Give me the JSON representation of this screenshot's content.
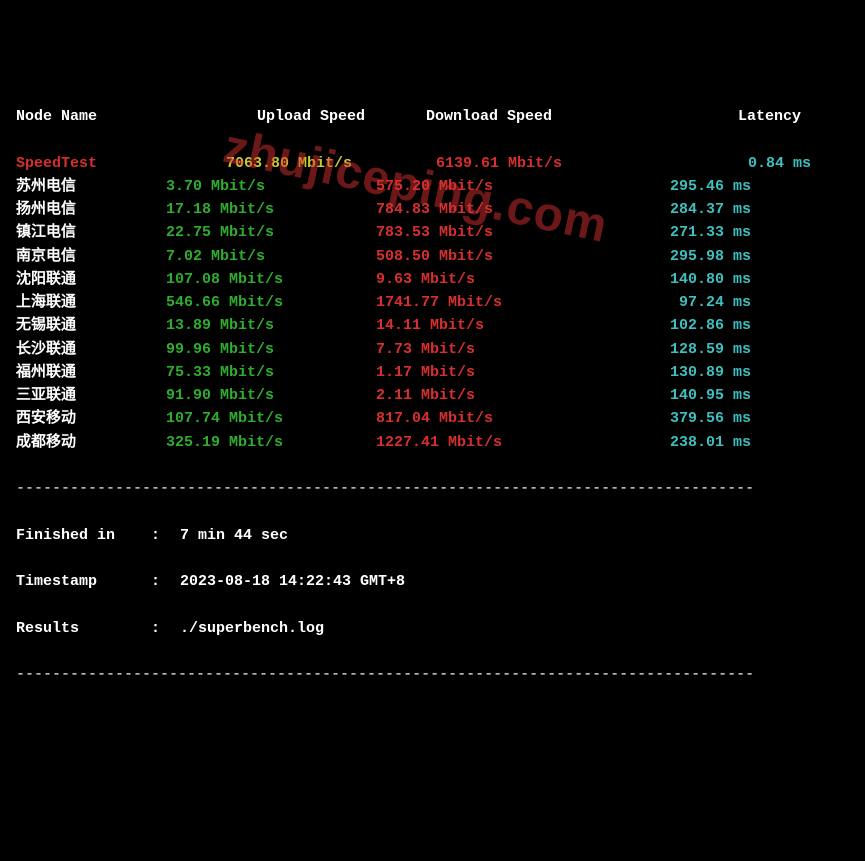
{
  "headers": {
    "node": "Node Name",
    "upload": "Upload Speed",
    "download": "Download Speed",
    "latency": "Latency"
  },
  "rows": [
    {
      "node": "SpeedTest",
      "node_color": "red",
      "upload": "7063.80 Mbit/s",
      "upload_color": "yellow",
      "download": "6139.61 Mbit/s",
      "download_color": "red",
      "latency": "0.84 ms",
      "latency_color": "cyan"
    },
    {
      "node": "苏州电信",
      "node_color": "white",
      "upload": "3.70 Mbit/s",
      "upload_color": "green",
      "download": "575.20 Mbit/s",
      "download_color": "red",
      "latency": "295.46 ms",
      "latency_color": "cyan"
    },
    {
      "node": "扬州电信",
      "node_color": "white",
      "upload": "17.18 Mbit/s",
      "upload_color": "green",
      "download": "784.83 Mbit/s",
      "download_color": "red",
      "latency": "284.37 ms",
      "latency_color": "cyan"
    },
    {
      "node": "镇江电信",
      "node_color": "white",
      "upload": "22.75 Mbit/s",
      "upload_color": "green",
      "download": "783.53 Mbit/s",
      "download_color": "red",
      "latency": "271.33 ms",
      "latency_color": "cyan"
    },
    {
      "node": "南京电信",
      "node_color": "white",
      "upload": "7.02 Mbit/s",
      "upload_color": "green",
      "download": "508.50 Mbit/s",
      "download_color": "red",
      "latency": "295.98 ms",
      "latency_color": "cyan"
    },
    {
      "node": "沈阳联通",
      "node_color": "white",
      "upload": "107.08 Mbit/s",
      "upload_color": "green",
      "download": "9.63 Mbit/s",
      "download_color": "red",
      "latency": "140.80 ms",
      "latency_color": "cyan"
    },
    {
      "node": "上海联通",
      "node_color": "white",
      "upload": "546.66 Mbit/s",
      "upload_color": "green",
      "download": "1741.77 Mbit/s",
      "download_color": "red",
      "latency": "97.24 ms",
      "latency_color": "cyan"
    },
    {
      "node": "无锡联通",
      "node_color": "white",
      "upload": "13.89 Mbit/s",
      "upload_color": "green",
      "download": "14.11 Mbit/s",
      "download_color": "red",
      "latency": "102.86 ms",
      "latency_color": "cyan"
    },
    {
      "node": "长沙联通",
      "node_color": "white",
      "upload": "99.96 Mbit/s",
      "upload_color": "green",
      "download": "7.73 Mbit/s",
      "download_color": "red",
      "latency": "128.59 ms",
      "latency_color": "cyan"
    },
    {
      "node": "福州联通",
      "node_color": "white",
      "upload": "75.33 Mbit/s",
      "upload_color": "green",
      "download": "1.17 Mbit/s",
      "download_color": "red",
      "latency": "130.89 ms",
      "latency_color": "cyan"
    },
    {
      "node": "三亚联通",
      "node_color": "white",
      "upload": "91.90 Mbit/s",
      "upload_color": "green",
      "download": "2.11 Mbit/s",
      "download_color": "red",
      "latency": "140.95 ms",
      "latency_color": "cyan"
    },
    {
      "node": "西安移动",
      "node_color": "white",
      "upload": "107.74 Mbit/s",
      "upload_color": "green",
      "download": "817.04 Mbit/s",
      "download_color": "red",
      "latency": "379.56 ms",
      "latency_color": "cyan"
    },
    {
      "node": "成都移动",
      "node_color": "white",
      "upload": "325.19 Mbit/s",
      "upload_color": "green",
      "download": "1227.41 Mbit/s",
      "download_color": "red",
      "latency": "238.01 ms",
      "latency_color": "cyan"
    }
  ],
  "divider": "----------------------------------------------------------------------------------",
  "footer": {
    "finished_label": "Finished in",
    "finished_value": "7 min 44 sec",
    "timestamp_label": "Timestamp",
    "timestamp_value": "2023-08-18 14:22:43 GMT+8",
    "results_label": "Results",
    "results_value": "./superbench.log",
    "sep": ":"
  },
  "watermark": "zhujiceping.com"
}
